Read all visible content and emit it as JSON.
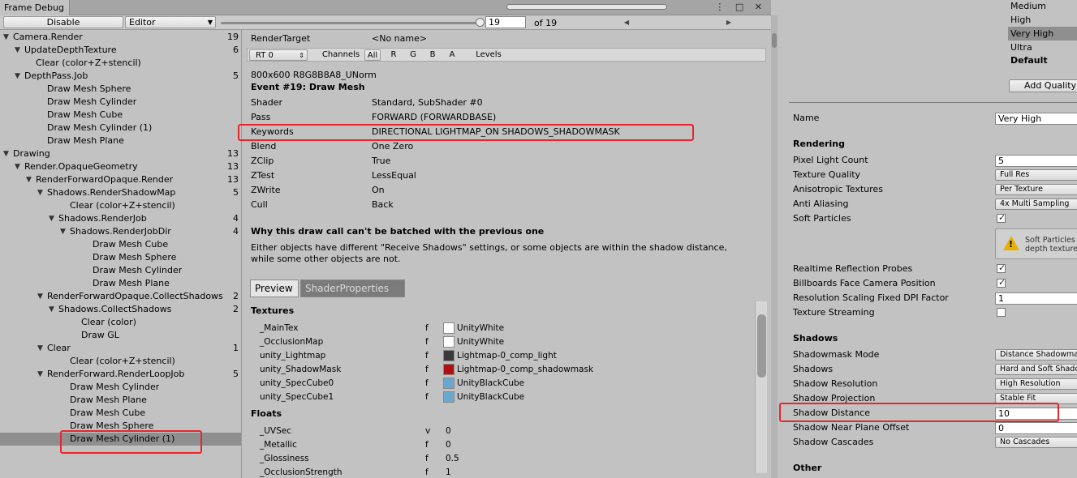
{
  "window": {
    "tab_title": "Frame Debug",
    "controls": "⋮ □ ✕"
  },
  "toolbar": {
    "disable_label": "Disable",
    "target_select": "Editor",
    "frame_value": "19",
    "frame_total": "of 19",
    "prev_icon": "◀",
    "next_icon": "▶"
  },
  "tree": [
    {
      "label": "Camera.Render",
      "count": "19",
      "depth": 0,
      "expanded": true
    },
    {
      "label": "UpdateDepthTexture",
      "count": "6",
      "depth": 1,
      "expanded": true
    },
    {
      "label": "Clear (color+Z+stencil)",
      "count": "",
      "depth": 2
    },
    {
      "label": "DepthPass.Job",
      "count": "5",
      "depth": 1,
      "expanded": true
    },
    {
      "label": "Draw Mesh Sphere",
      "count": "",
      "depth": 3
    },
    {
      "label": "Draw Mesh Cylinder",
      "count": "",
      "depth": 3
    },
    {
      "label": "Draw Mesh Cube",
      "count": "",
      "depth": 3
    },
    {
      "label": "Draw Mesh Cylinder (1)",
      "count": "",
      "depth": 3
    },
    {
      "label": "Draw Mesh Plane",
      "count": "",
      "depth": 3
    },
    {
      "label": "Drawing",
      "count": "13",
      "depth": 0,
      "expanded": true
    },
    {
      "label": "Render.OpaqueGeometry",
      "count": "13",
      "depth": 1,
      "expanded": true
    },
    {
      "label": "RenderForwardOpaque.Render",
      "count": "13",
      "depth": 2,
      "expanded": true
    },
    {
      "label": "Shadows.RenderShadowMap",
      "count": "5",
      "depth": 3,
      "expanded": true
    },
    {
      "label": "Clear (color+Z+stencil)",
      "count": "",
      "depth": 5
    },
    {
      "label": "Shadows.RenderJob",
      "count": "4",
      "depth": 4,
      "expanded": true
    },
    {
      "label": "Shadows.RenderJobDir",
      "count": "4",
      "depth": 5,
      "expanded": true
    },
    {
      "label": "Draw Mesh Cube",
      "count": "",
      "depth": 7
    },
    {
      "label": "Draw Mesh Sphere",
      "count": "",
      "depth": 7
    },
    {
      "label": "Draw Mesh Cylinder",
      "count": "",
      "depth": 7
    },
    {
      "label": "Draw Mesh Plane",
      "count": "",
      "depth": 7
    },
    {
      "label": "RenderForwardOpaque.CollectShadows",
      "count": "2",
      "depth": 3,
      "expanded": true
    },
    {
      "label": "Shadows.CollectShadows",
      "count": "2",
      "depth": 4,
      "expanded": true
    },
    {
      "label": "Clear (color)",
      "count": "",
      "depth": 6
    },
    {
      "label": "Draw GL",
      "count": "",
      "depth": 6
    },
    {
      "label": "Clear",
      "count": "1",
      "depth": 3,
      "expanded": true
    },
    {
      "label": "Clear (color+Z+stencil)",
      "count": "",
      "depth": 5
    },
    {
      "label": "RenderForward.RenderLoopJob",
      "count": "5",
      "depth": 3,
      "expanded": true
    },
    {
      "label": "Draw Mesh Cylinder",
      "count": "",
      "depth": 5
    },
    {
      "label": "Draw Mesh Plane",
      "count": "",
      "depth": 5
    },
    {
      "label": "Draw Mesh Cube",
      "count": "",
      "depth": 5
    },
    {
      "label": "Draw Mesh Sphere",
      "count": "",
      "depth": 5
    },
    {
      "label": "Draw Mesh Cylinder (1)",
      "count": "",
      "depth": 5,
      "selected": true
    }
  ],
  "detail": {
    "render_target_label": "RenderTarget",
    "render_target_value": "<No name>",
    "rt_select": "RT 0",
    "channels_label": "Channels",
    "channel_buttons": [
      "All",
      "R",
      "G",
      "B",
      "A"
    ],
    "levels_label": "Levels",
    "format": "800x600 R8G8B8A8_UNorm",
    "event_title": "Event #19: Draw Mesh",
    "state": [
      {
        "k": "Shader",
        "v": "Standard, SubShader #0"
      },
      {
        "k": "Pass",
        "v": "FORWARD (FORWARDBASE)"
      },
      {
        "k": "Keywords",
        "v": "DIRECTIONAL LIGHTMAP_ON SHADOWS_SHADOWMASK"
      },
      {
        "k": "Blend",
        "v": "One Zero"
      },
      {
        "k": "ZClip",
        "v": "True"
      },
      {
        "k": "ZTest",
        "v": "LessEqual"
      },
      {
        "k": "ZWrite",
        "v": "On"
      },
      {
        "k": "Cull",
        "v": "Back"
      }
    ],
    "batch_title": "Why this draw call can't be batched with the previous one",
    "batch_text_1": "Either objects have different \"Receive Shadows\" settings, or some objects are within the shadow distance,",
    "batch_text_2": "while some other objects are not.",
    "tab_preview": "Preview",
    "tab_shader_props": "ShaderProperties",
    "textures_title": "Textures",
    "textures": [
      {
        "name": "_MainTex",
        "flag": "f",
        "value": "UnityWhite",
        "swatch": "#ffffff"
      },
      {
        "name": "_OcclusionMap",
        "flag": "f",
        "value": "UnityWhite",
        "swatch": "#ffffff"
      },
      {
        "name": "unity_Lightmap",
        "flag": "f",
        "value": "Lightmap-0_comp_light",
        "swatch": "#3a3a3a"
      },
      {
        "name": "unity_ShadowMask",
        "flag": "f",
        "value": "Lightmap-0_comp_shadowmask",
        "swatch": "#b01010"
      },
      {
        "name": "unity_SpecCube0",
        "flag": "f",
        "value": "UnityBlackCube",
        "swatch": "#6aa8d0"
      },
      {
        "name": "unity_SpecCube1",
        "flag": "f",
        "value": "UnityBlackCube",
        "swatch": "#6aa8d0"
      }
    ],
    "floats_title": "Floats",
    "floats": [
      {
        "name": "_UVSec",
        "flag": "v",
        "value": "0"
      },
      {
        "name": "_Metallic",
        "flag": "f",
        "value": "0"
      },
      {
        "name": "_Glossiness",
        "flag": "f",
        "value": "0.5"
      },
      {
        "name": "_OcclusionStrength",
        "flag": "f",
        "value": "1"
      }
    ]
  },
  "quality": {
    "levels": [
      "Medium",
      "High",
      "Very High",
      "Ultra"
    ],
    "selected_level": "Very High",
    "default_label": "Default",
    "add_button": "Add Quality",
    "name_label": "Name",
    "name_value": "Very High",
    "rendering_header": "Rendering",
    "rendering": [
      {
        "label": "Pixel Light Count",
        "type": "field",
        "value": "5"
      },
      {
        "label": "Texture Quality",
        "type": "drop",
        "value": "Full Res"
      },
      {
        "label": "Anisotropic Textures",
        "type": "drop",
        "value": "Per Texture"
      },
      {
        "label": "Anti Aliasing",
        "type": "drop",
        "value": "4x Multi Sampling"
      },
      {
        "label": "Soft Particles",
        "type": "check",
        "checked": true
      }
    ],
    "warning_line1": "Soft Particles",
    "warning_line2": "depth texture",
    "rendering2": [
      {
        "label": "Realtime Reflection Probes",
        "type": "check",
        "checked": true
      },
      {
        "label": "Billboards Face Camera Position",
        "type": "check",
        "checked": true
      },
      {
        "label": "Resolution Scaling Fixed DPI Factor",
        "type": "field",
        "value": "1"
      },
      {
        "label": "Texture Streaming",
        "type": "check",
        "checked": false
      }
    ],
    "shadows_header": "Shadows",
    "shadows": [
      {
        "label": "Shadowmask Mode",
        "type": "drop",
        "value": "Distance Shadowmask"
      },
      {
        "label": "Shadows",
        "type": "drop",
        "value": "Hard and Soft Shadows"
      },
      {
        "label": "Shadow Resolution",
        "type": "drop",
        "value": "High Resolution"
      },
      {
        "label": "Shadow Projection",
        "type": "drop",
        "value": "Stable Fit"
      },
      {
        "label": "Shadow Distance",
        "type": "field",
        "value": "10"
      },
      {
        "label": "Shadow Near Plane Offset",
        "type": "field",
        "value": "0"
      },
      {
        "label": "Shadow Cascades",
        "type": "drop",
        "value": "No Cascades"
      }
    ],
    "other_header": "Other"
  }
}
